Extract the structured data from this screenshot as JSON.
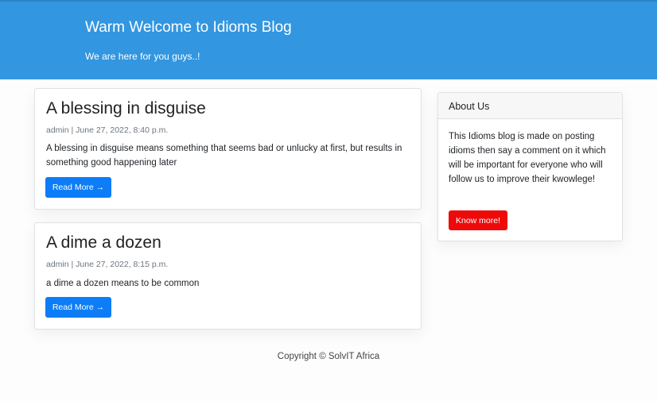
{
  "header": {
    "title": "Warm Welcome to Idioms Blog",
    "subtitle": "We are here for you guys..!"
  },
  "posts": [
    {
      "title": "A blessing in disguise",
      "meta": "admin | June 27, 2022, 8:40 p.m.",
      "excerpt": "A blessing in disguise means something that seems bad or unlucky at first, but results in something good happening later",
      "button_label": "Read More →"
    },
    {
      "title": "A dime a dozen",
      "meta": "admin | June 27, 2022, 8:15 p.m.",
      "excerpt": "a dime a dozen means to be common",
      "button_label": "Read More →"
    }
  ],
  "sidebar": {
    "title": "About Us",
    "text": "This Idioms blog is made on posting idioms then say a comment on it which will be important for everyone who will follow us to improve their kwowlege!",
    "button_label": "Know more!"
  },
  "footer": {
    "copyright": "Copyright © SolvIT Africa"
  },
  "colors": {
    "header_bg": "#3296e0",
    "primary_button": "#0d7df7",
    "danger_button": "#ee0a0a"
  }
}
